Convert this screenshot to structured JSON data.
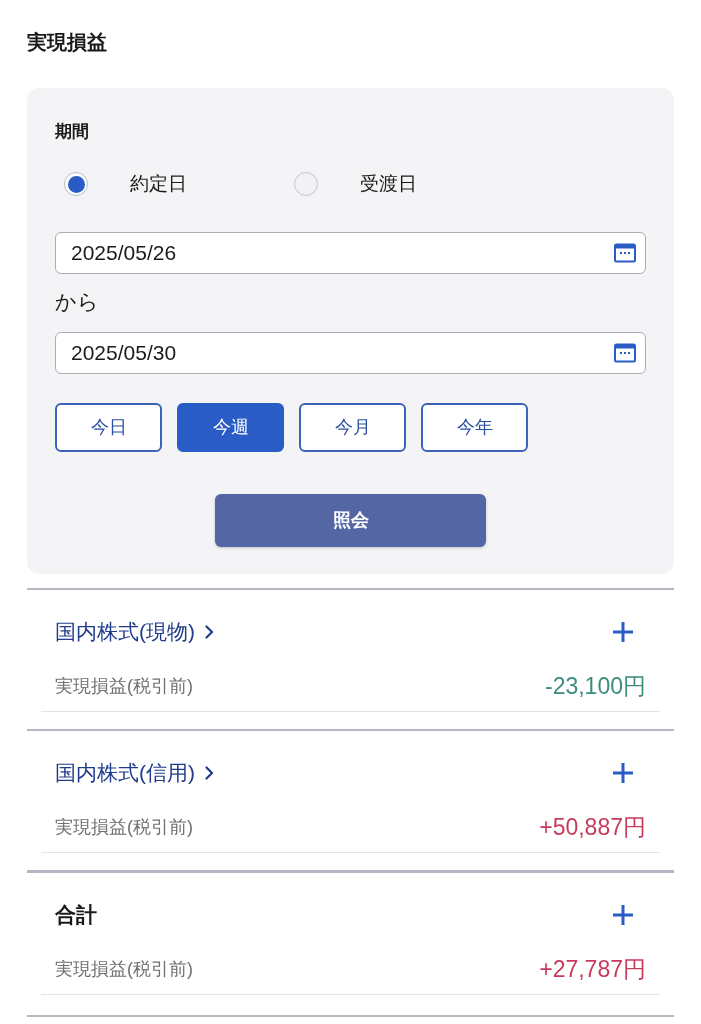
{
  "title": "実現損益",
  "filter": {
    "label": "期間",
    "date_type": [
      {
        "label": "約定日",
        "selected": true
      },
      {
        "label": "受渡日",
        "selected": false
      }
    ],
    "start_date": {
      "value": "2025/05/26"
    },
    "separator": "から",
    "end_date": {
      "value": "2025/05/30"
    },
    "presets": [
      {
        "label": "今日",
        "selected": false
      },
      {
        "label": "今週",
        "selected": true
      },
      {
        "label": "今月",
        "selected": false
      },
      {
        "label": "今年",
        "selected": false
      }
    ],
    "submit": "照会"
  },
  "sections": [
    {
      "kind": "category",
      "title": "国内株式(現物)",
      "rows": [
        {
          "label": "実現損益(税引前)",
          "value": "-23,100円",
          "color": "#3d8c7c"
        }
      ]
    },
    {
      "kind": "category",
      "title": "国内株式(信用)",
      "rows": [
        {
          "label": "実現損益(税引前)",
          "value": "+50,887円",
          "color": "#c83a5c"
        }
      ]
    },
    {
      "kind": "total",
      "title": "合計",
      "rows": [
        {
          "label": "実現損益(税引前)",
          "value": "+27,787円",
          "color": "#c83a5c"
        }
      ]
    }
  ]
}
